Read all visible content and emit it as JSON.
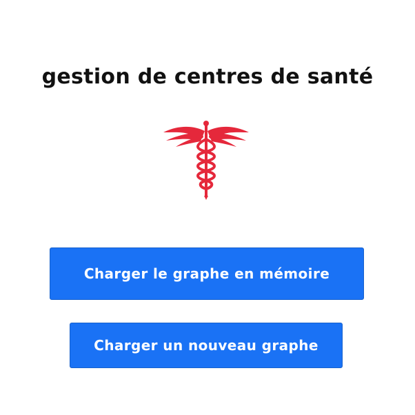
{
  "app": {
    "title": "gestion de centres de santé"
  },
  "logo": {
    "icon": "caduceus-icon",
    "color": "#e5283b"
  },
  "buttons": {
    "load_memory_label": "Charger le graphe en mémoire",
    "load_new_label": "Charger un nouveau graphe"
  },
  "colors": {
    "button_bg": "#1a72f5",
    "button_text": "#ffffff",
    "title_text": "#111111"
  }
}
